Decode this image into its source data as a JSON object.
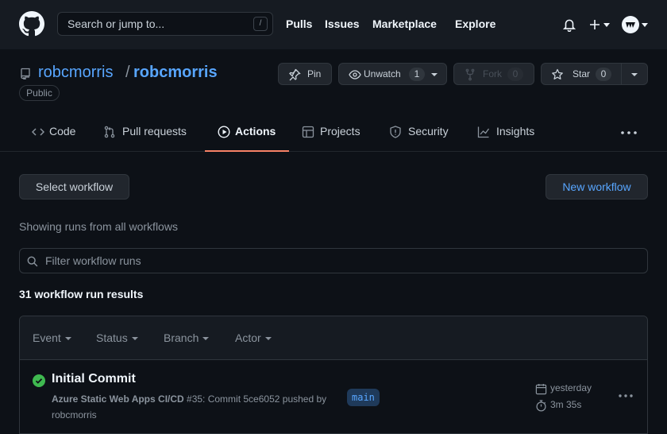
{
  "header": {
    "search_placeholder": "Search or jump to...",
    "search_shortcut": "/",
    "nav": [
      "Pulls",
      "Issues",
      "Marketplace",
      "Explore"
    ]
  },
  "repo": {
    "owner": "robcmorris",
    "separator": "/",
    "name": "robcmorris",
    "visibility": "Public",
    "pin_label": "Pin",
    "watch_label": "Unwatch",
    "watch_count": "1",
    "fork_label": "Fork",
    "fork_count": "0",
    "star_label": "Star",
    "star_count": "0"
  },
  "tabs": [
    {
      "label": "Code",
      "icon": "code-icon"
    },
    {
      "label": "Pull requests",
      "icon": "pull-request-icon"
    },
    {
      "label": "Actions",
      "icon": "play-icon",
      "active": true
    },
    {
      "label": "Projects",
      "icon": "table-icon"
    },
    {
      "label": "Security",
      "icon": "shield-icon"
    },
    {
      "label": "Insights",
      "icon": "graph-icon"
    }
  ],
  "actions": {
    "select_workflow": "Select workflow",
    "new_workflow": "New workflow",
    "showing": "Showing runs from all workflows",
    "filter_placeholder": "Filter workflow runs",
    "results": "31 workflow run results",
    "filters": [
      "Event",
      "Status",
      "Branch",
      "Actor"
    ]
  },
  "runs": [
    {
      "title": "Initial Commit",
      "workflow": "Azure Static Web Apps CI/CD",
      "detail": "#35: Commit 5ce6052 pushed by robcmorris",
      "branch": "main",
      "date": "yesterday",
      "duration": "3m 35s",
      "status": "success"
    }
  ],
  "colors": {
    "background": "#0d1117",
    "header": "#161b22",
    "link": "#58a6ff",
    "success": "#3fb950",
    "active_tab_underline": "#f78166"
  }
}
